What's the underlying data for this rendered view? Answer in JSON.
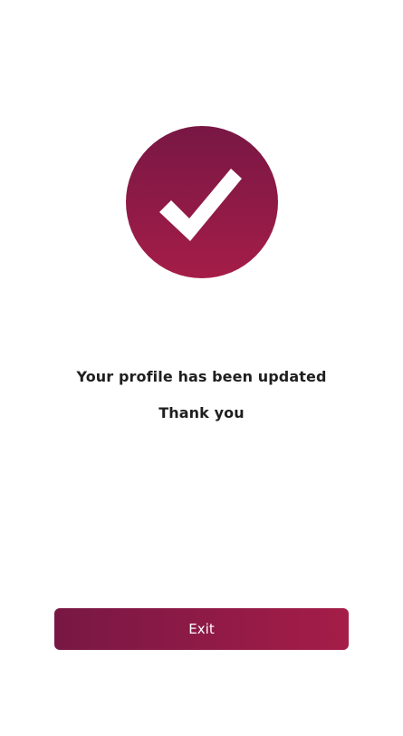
{
  "success": {
    "icon": "checkmark-icon",
    "colors": {
      "gradient_start": "#781744",
      "gradient_end": "#a51d48",
      "check": "#ffffff"
    }
  },
  "messages": {
    "primary": "Your profile has been updated",
    "secondary": "Thank you"
  },
  "actions": {
    "exit_label": "Exit"
  }
}
